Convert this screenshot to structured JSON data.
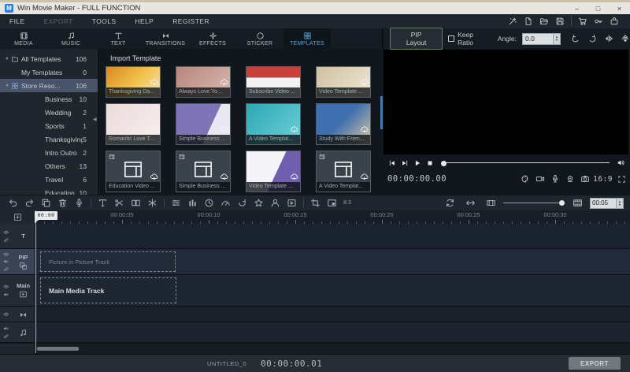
{
  "window": {
    "title": "Win Movie Maker - FULL FUNCTION",
    "logo": "M",
    "controls": [
      {
        "name": "minimize-button",
        "glyph": "–"
      },
      {
        "name": "maximize-button",
        "glyph": "□"
      },
      {
        "name": "close-button",
        "glyph": "×"
      }
    ]
  },
  "menubar": {
    "items": [
      {
        "name": "menu-file",
        "label": "FILE",
        "cls": ""
      },
      {
        "name": "menu-export",
        "label": "EXPORT",
        "cls": "dim"
      },
      {
        "name": "menu-tools",
        "label": "TOOLS",
        "cls": ""
      },
      {
        "name": "menu-help",
        "label": "HELP",
        "cls": ""
      },
      {
        "name": "menu-register",
        "label": "REGISTER",
        "cls": ""
      }
    ],
    "right_icons": [
      {
        "name": "magic-wand-icon",
        "icon": "wand"
      },
      {
        "name": "new-file-icon",
        "icon": "page"
      },
      {
        "name": "open-folder-icon",
        "icon": "open"
      },
      {
        "name": "save-icon",
        "icon": "save"
      },
      {
        "name": "toolbar-divider",
        "icon": "",
        "cls": "vsep"
      },
      {
        "name": "cart-icon",
        "icon": "cart"
      },
      {
        "name": "key-icon",
        "icon": "key"
      },
      {
        "name": "bag-icon",
        "icon": "bag"
      }
    ]
  },
  "tabs": [
    {
      "name": "tab-media",
      "label": "MEDIA",
      "icon": "film",
      "cls": ""
    },
    {
      "name": "tab-music",
      "label": "MUSIC",
      "icon": "note",
      "cls": ""
    },
    {
      "name": "tab-text",
      "label": "TEXT",
      "icon": "textT",
      "cls": ""
    },
    {
      "name": "tab-transitions",
      "label": "TRANSITIONS",
      "icon": "bowtie",
      "cls": ""
    },
    {
      "name": "tab-effects",
      "label": "EFFECTS",
      "icon": "sparkle",
      "cls": ""
    },
    {
      "name": "tab-sticker",
      "label": "STICKER",
      "icon": "sticker",
      "cls": ""
    },
    {
      "name": "tab-templates",
      "label": "TEMPLATES",
      "icon": "grid",
      "cls": "active"
    }
  ],
  "pip": {
    "layout_button": "PIP Layout",
    "keep_ratio_label": "Keep Ratio",
    "angle_label": "Angle:",
    "angle_value": "0.0",
    "icons": [
      {
        "name": "rotate-left-icon",
        "icon": "rotl"
      },
      {
        "name": "rotate-right-icon",
        "icon": "rotr"
      },
      {
        "name": "flip-horizontal-icon",
        "icon": "fliph"
      },
      {
        "name": "flip-vertical-icon",
        "icon": "flipv"
      }
    ]
  },
  "sidebar": {
    "items": [
      {
        "name": "sidebar-item-all-templates",
        "label": "All Templates",
        "count": "106",
        "caret": "▾",
        "icon": "folder",
        "cls": ""
      },
      {
        "name": "sidebar-item-my-templates",
        "label": "My Templates",
        "count": "0",
        "caret": "",
        "icon": "",
        "cls": ""
      },
      {
        "name": "sidebar-item-store-resources",
        "label": "Store Reso...",
        "count": "106",
        "caret": "▾",
        "icon": "grid",
        "cls": "sel"
      },
      {
        "name": "sidebar-item-business",
        "label": "Business",
        "count": "10",
        "caret": "",
        "icon": "",
        "cls": "lv1"
      },
      {
        "name": "sidebar-item-wedding",
        "label": "Wedding",
        "count": "2",
        "caret": "",
        "icon": "",
        "cls": "lv1"
      },
      {
        "name": "sidebar-item-sports",
        "label": "Sports",
        "count": "1",
        "caret": "",
        "icon": "",
        "cls": "lv1"
      },
      {
        "name": "sidebar-item-thanksgiving",
        "label": "Thanksgiving",
        "count": "5",
        "caret": "",
        "icon": "",
        "cls": "lv1"
      },
      {
        "name": "sidebar-item-intro-outro",
        "label": "Intro Outro",
        "count": "2",
        "caret": "",
        "icon": "",
        "cls": "lv1"
      },
      {
        "name": "sidebar-item-others",
        "label": "Others",
        "count": "13",
        "caret": "",
        "icon": "",
        "cls": "lv1"
      },
      {
        "name": "sidebar-item-travel",
        "label": "Travel",
        "count": "6",
        "caret": "",
        "icon": "",
        "cls": "lv1"
      },
      {
        "name": "sidebar-item-education",
        "label": "Education",
        "count": "10",
        "caret": "",
        "icon": "",
        "cls": "lv1"
      }
    ],
    "collapse_glyph": "◀"
  },
  "library": {
    "header": "Import Template",
    "templates": [
      {
        "name": "template-card",
        "label": "Thanksgiving Da...",
        "cls": "crop",
        "ph": false,
        "thumb": "linear-gradient(135deg,#d9891f,#f2c34d 55%,#f0e4c5)"
      },
      {
        "name": "template-card",
        "label": "Always Love Yo...",
        "cls": "crop",
        "ph": false,
        "thumb": "linear-gradient(135deg,#b7877f,#d9b8af)"
      },
      {
        "name": "template-card",
        "label": "Subscribe Video ...",
        "cls": "crop",
        "ph": false,
        "thumb": "linear-gradient(180deg,#c8403a 0%,#c8403a 35%,#f2f2f0 35%)"
      },
      {
        "name": "template-card",
        "label": "Video Template ...",
        "cls": "crop",
        "ph": false,
        "thumb": "linear-gradient(135deg,#cfc0a2,#efe6d2)"
      },
      {
        "name": "template-card",
        "label": "Romantic Love T...",
        "cls": "",
        "ph": false,
        "thumb": "linear-gradient(135deg,#eddbdb,#f7efef)"
      },
      {
        "name": "template-card",
        "label": "Simple Business ...",
        "cls": "",
        "ph": false,
        "thumb": "linear-gradient(115deg,#7f74b5 62%,#e9e7f3 62%)"
      },
      {
        "name": "template-card",
        "label": "A Video Templat...",
        "cls": "",
        "ph": false,
        "thumb": "linear-gradient(135deg,#2aa8b4,#70d0d8)"
      },
      {
        "name": "template-card",
        "label": "Study With Frien...",
        "cls": "",
        "ph": false,
        "thumb": "linear-gradient(135deg,#3f6fae 45%,#d9c9a8)"
      },
      {
        "name": "template-card",
        "label": "Education Video ...",
        "cls": "",
        "ph": true,
        "thumb": ""
      },
      {
        "name": "template-card",
        "label": "Simple Business ...",
        "cls": "",
        "ph": true,
        "thumb": ""
      },
      {
        "name": "template-card",
        "label": "Video Template ...",
        "cls": "",
        "ph": false,
        "thumb": "linear-gradient(115deg,#f5f4f8 55%,#6f5fae 55%)"
      },
      {
        "name": "template-card",
        "label": "A Video Templat...",
        "cls": "",
        "ph": true,
        "thumb": ""
      }
    ]
  },
  "preview": {
    "timecode": "00:00:00.00",
    "aspect_ratio": "16:9",
    "transport": [
      {
        "name": "previous-frame-button",
        "icon": "skipb"
      },
      {
        "name": "next-frame-button",
        "icon": "skipf"
      },
      {
        "name": "play-button",
        "icon": "play"
      },
      {
        "name": "stop-button",
        "icon": "stop"
      }
    ],
    "info_icons": [
      {
        "name": "color-palette-icon",
        "icon": "palette"
      },
      {
        "name": "video-camera-icon",
        "icon": "cam"
      },
      {
        "name": "microphone-icon",
        "icon": "mic"
      },
      {
        "name": "webcam-icon",
        "icon": "reccam"
      },
      {
        "name": "snapshot-icon",
        "icon": "photo"
      }
    ]
  },
  "timeline": {
    "tools": [
      {
        "name": "undo-button",
        "icon": "undo",
        "cls": ""
      },
      {
        "name": "redo-button",
        "icon": "redo",
        "cls": ""
      },
      {
        "name": "copy-button",
        "icon": "copy",
        "cls": ""
      },
      {
        "name": "delete-button",
        "icon": "trash",
        "cls": ""
      },
      {
        "name": "voiceover-button",
        "icon": "mic",
        "cls": ""
      },
      {
        "name": "tool-divider",
        "icon": "",
        "cls": "vsep"
      },
      {
        "name": "text-tool-button",
        "icon": "textT",
        "cls": ""
      },
      {
        "name": "split-button",
        "icon": "scissors",
        "cls": ""
      },
      {
        "name": "detach-button",
        "icon": "detach",
        "cls": ""
      },
      {
        "name": "freeze-frame-button",
        "icon": "freeze",
        "cls": ""
      },
      {
        "name": "tool-divider",
        "icon": "",
        "cls": "vsep"
      },
      {
        "name": "adjust-button",
        "icon": "sliders",
        "cls": ""
      },
      {
        "name": "audio-mixer-button",
        "icon": "mixer",
        "cls": ""
      },
      {
        "name": "duration-button",
        "icon": "clock",
        "cls": ""
      },
      {
        "name": "speed-button",
        "icon": "speed",
        "cls": ""
      },
      {
        "name": "rotate-button",
        "icon": "rotate",
        "cls": ""
      },
      {
        "name": "effects-button",
        "icon": "star",
        "cls": ""
      },
      {
        "name": "portrait-button",
        "icon": "person",
        "cls": ""
      },
      {
        "name": "frame-button",
        "icon": "frame",
        "cls": ""
      },
      {
        "name": "tool-divider",
        "icon": "",
        "cls": "vsep"
      },
      {
        "name": "crop-button",
        "icon": "crop",
        "cls": ""
      },
      {
        "name": "pip-layout-tool-button",
        "icon": "pip",
        "cls": ""
      },
      {
        "name": "aspect-ratio-tool-label",
        "icon": "",
        "label": "8:3",
        "cls": "lbl"
      }
    ],
    "right_tools": [
      {
        "name": "render-preview-button",
        "icon": "sync"
      },
      {
        "name": "fit-timeline-button",
        "icon": "harrows"
      },
      {
        "name": "track-height-button",
        "icon": "filmsm"
      }
    ],
    "clip_view_icon": "film2",
    "clip_duration_value": "00:05",
    "ruler_labels": [
      "00:00:00",
      "00:00:05",
      "00:00:10",
      "00:00:15",
      "00:00:20",
      "00:00:25",
      "00:00:30"
    ],
    "playhead_label": "00:00",
    "tracks": [
      {
        "name": "track-text",
        "cls": "tr-text",
        "i1": "eye",
        "i2": "link",
        "i3": "",
        "label": "T",
        "ticon": "",
        "clip": "",
        "clip_cls": "hide"
      },
      {
        "name": "track-pip",
        "cls": "tr-pip sel",
        "i1": "eye",
        "i2": "mute",
        "i3": "link",
        "label": "PIP",
        "ticon": "pipsq",
        "clip": "Picture in Picture Track",
        "clip_cls": "clip-pip"
      },
      {
        "name": "track-main",
        "cls": "tr-main",
        "i1": "eye",
        "i2": "mute",
        "i3": "",
        "label": "Main",
        "ticon": "playbox",
        "clip": "Main Media Track",
        "clip_cls": "clip-main"
      },
      {
        "name": "track-transition",
        "cls": "tr-trans",
        "i1": "eye",
        "i2": "",
        "i3": "",
        "label": "",
        "ticon": "bowtie",
        "clip": "",
        "clip_cls": "hide"
      },
      {
        "name": "track-audio",
        "cls": "tr-audio",
        "i1": "mute",
        "i2": "link",
        "i3": "",
        "label": "",
        "ticon": "note",
        "clip": "",
        "clip_cls": "hide"
      }
    ]
  },
  "statusbar": {
    "project_name": "UNTITLED_0",
    "timecode": "00:00:00.01",
    "export_label": "EXPORT"
  },
  "colors": {
    "accent_blue": "#53a7e0",
    "selection_blue": "#49536a",
    "scrollbar_blue": "#2f81d8",
    "pip_button_border_green": "#5b8a4e",
    "titlebar_light": "#e9e6e1",
    "panel_dark": "#161c23"
  }
}
